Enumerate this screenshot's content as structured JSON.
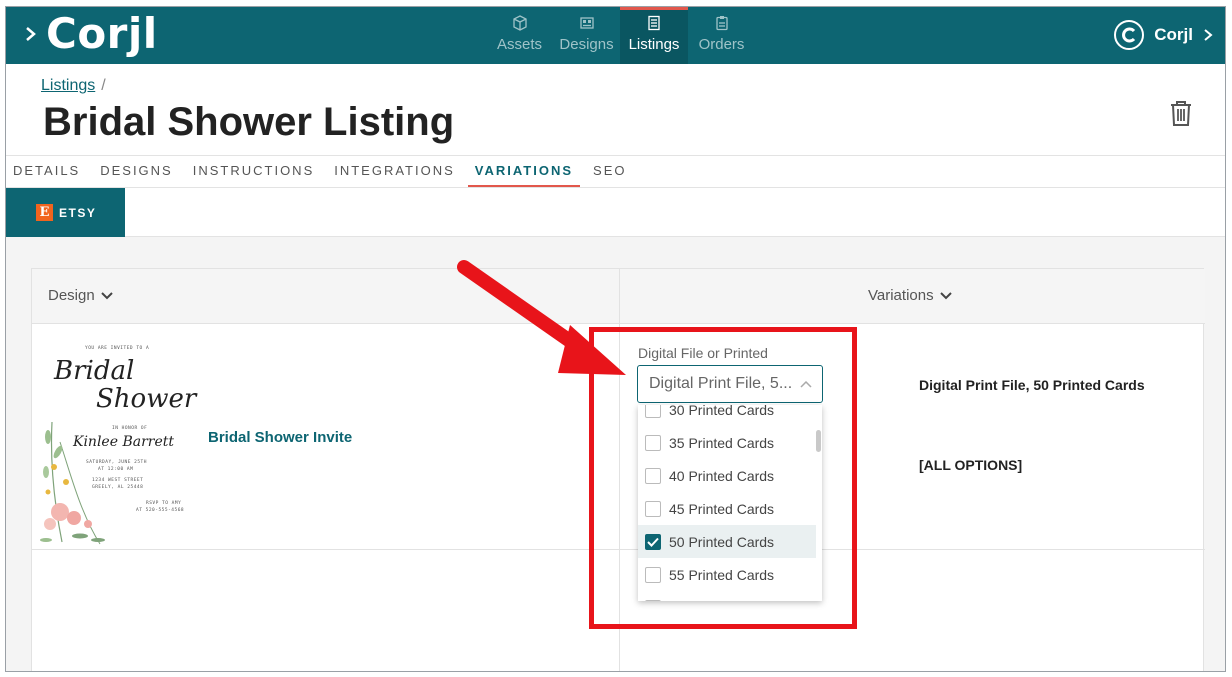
{
  "app": {
    "brand": "Corjl"
  },
  "nav": [
    {
      "label": "Assets",
      "icon": "cube-icon",
      "active": false
    },
    {
      "label": "Designs",
      "icon": "designs-icon",
      "active": false
    },
    {
      "label": "Listings",
      "icon": "listings-icon",
      "active": true
    },
    {
      "label": "Orders",
      "icon": "orders-icon",
      "active": false
    }
  ],
  "account": {
    "label": "Corjl"
  },
  "breadcrumb": {
    "parent": "Listings",
    "separator": "/"
  },
  "page": {
    "title": "Bridal Shower Listing"
  },
  "tabs": [
    {
      "label": "DETAILS",
      "active": false
    },
    {
      "label": "DESIGNS",
      "active": false
    },
    {
      "label": "INSTRUCTIONS",
      "active": false
    },
    {
      "label": "INTEGRATIONS",
      "active": false
    },
    {
      "label": "VARIATIONS",
      "active": true
    },
    {
      "label": "SEO",
      "active": false
    }
  ],
  "platform_tab": {
    "logo_letter": "E",
    "label": "ETSY"
  },
  "table": {
    "headers": {
      "design": "Design",
      "variations": "Variations"
    },
    "row": {
      "design_name": "Bridal Shower Invite",
      "invite": {
        "line1": "YOU ARE INVITED TO A",
        "script1": "Bridal",
        "script2": "Shower",
        "honor": "IN HONOR OF",
        "name": "Kinlee Barrett",
        "date1": "SATURDAY, JUNE 25TH",
        "date2": "AT 12:00 AM",
        "addr1": "1234 WEST STREET",
        "addr2": "GREELY, AL 25448",
        "rsvp1": "RSVP TO AMY",
        "rsvp2": "AT 520-555-4568"
      },
      "field_label": "Digital File or Printed",
      "select_value": "Digital Print File, 5...",
      "options": [
        {
          "label": "30 Printed Cards",
          "checked": false
        },
        {
          "label": "35 Printed Cards",
          "checked": false
        },
        {
          "label": "40 Printed Cards",
          "checked": false
        },
        {
          "label": "45 Printed Cards",
          "checked": false
        },
        {
          "label": "50 Printed Cards",
          "checked": true
        },
        {
          "label": "55 Printed Cards",
          "checked": false
        }
      ],
      "variation_value": "Digital Print File, 50 Printed Cards",
      "all_options": "[ALL OPTIONS]"
    }
  },
  "colors": {
    "brand": "#0d6572",
    "accent": "#e2574c",
    "annotation": "#e8141a",
    "etsy": "#f1641e"
  }
}
